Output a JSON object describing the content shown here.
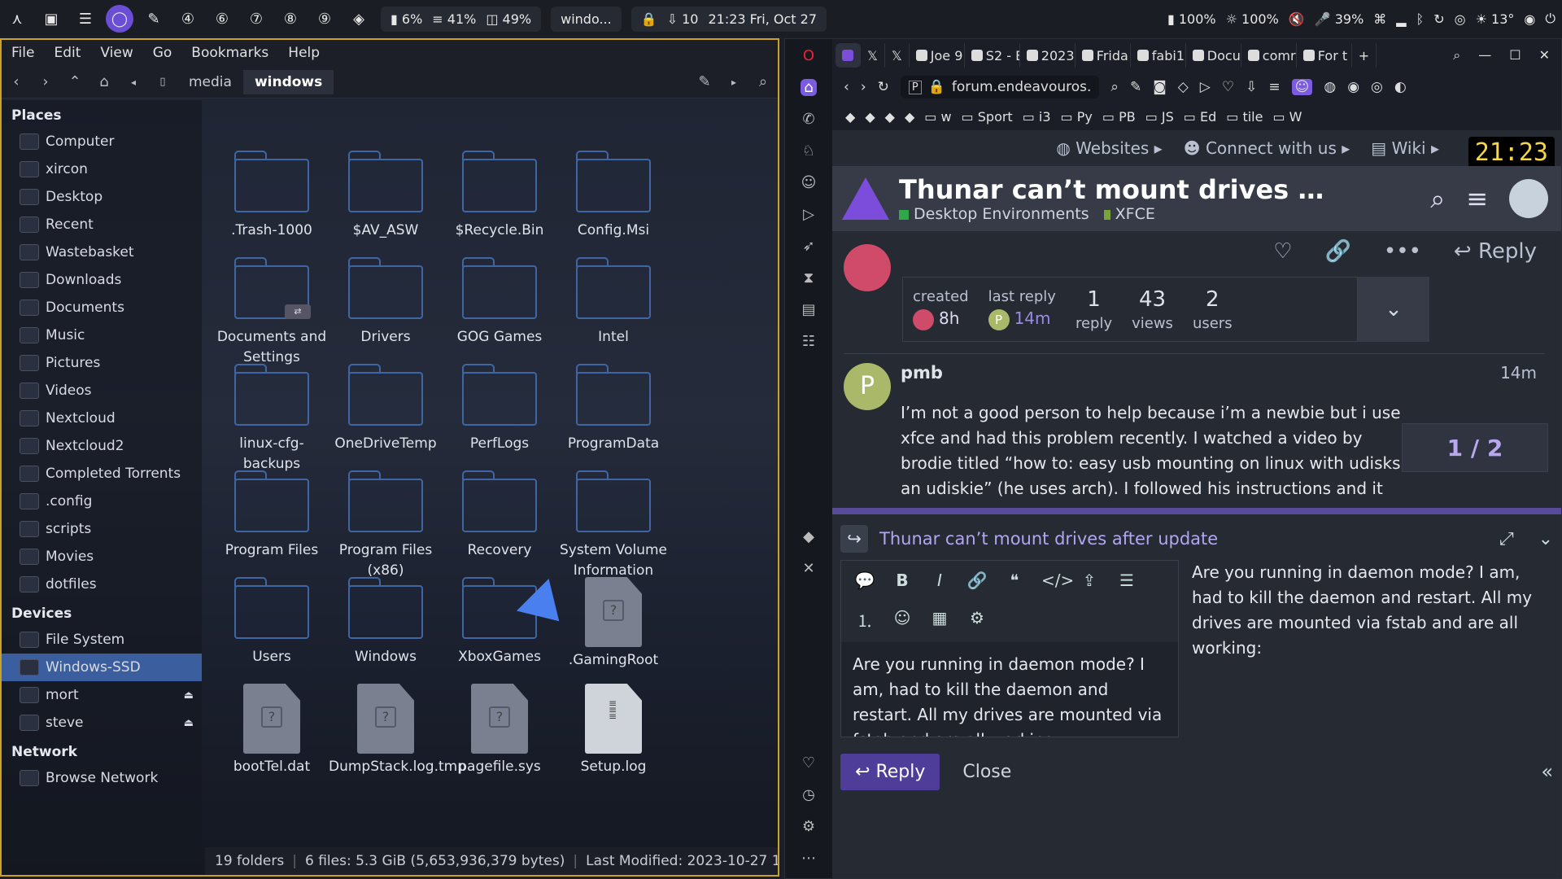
{
  "panel": {
    "cpu": "6%",
    "mem": "41%",
    "disk": "49%",
    "window_title": "windo...",
    "updates": "10",
    "datetime": "21:23 Fri, Oct 27",
    "battery": "100%",
    "brightness": "100%",
    "mic": "39%",
    "temp": "13°"
  },
  "fm": {
    "menu": [
      "File",
      "Edit",
      "View",
      "Go",
      "Bookmarks",
      "Help"
    ],
    "crumbs": [
      "media",
      "windows"
    ],
    "places_head": "Places",
    "places": [
      {
        "label": "Computer",
        "icon": "computer-icon"
      },
      {
        "label": "xircon",
        "icon": "home-folder-icon"
      },
      {
        "label": "Desktop",
        "icon": "desktop-icon"
      },
      {
        "label": "Recent",
        "icon": "recent-icon"
      },
      {
        "label": "Wastebasket",
        "icon": "trash-icon"
      },
      {
        "label": "Downloads",
        "icon": "downloads-folder-icon"
      },
      {
        "label": "Documents",
        "icon": "documents-folder-icon"
      },
      {
        "label": "Music",
        "icon": "music-folder-icon"
      },
      {
        "label": "Pictures",
        "icon": "pictures-folder-icon"
      },
      {
        "label": "Videos",
        "icon": "videos-folder-icon"
      },
      {
        "label": "Nextcloud",
        "icon": "nextcloud-folder-icon"
      },
      {
        "label": "Nextcloud2",
        "icon": "nextcloud-folder-icon"
      },
      {
        "label": "Completed Torrents",
        "icon": "torrent-folder-icon"
      },
      {
        "label": ".config",
        "icon": "folder-icon"
      },
      {
        "label": "scripts",
        "icon": "folder-icon"
      },
      {
        "label": "Movies",
        "icon": "folder-icon"
      },
      {
        "label": "dotfiles",
        "icon": "folder-icon"
      }
    ],
    "devices_head": "Devices",
    "devices": [
      {
        "label": "File System",
        "eject": false
      },
      {
        "label": "Windows-SSD",
        "eject": false
      },
      {
        "label": "mort",
        "eject": true
      },
      {
        "label": "steve",
        "eject": true
      }
    ],
    "network_head": "Network",
    "network": [
      {
        "label": "Browse Network"
      }
    ],
    "items": [
      {
        "label": ".Trash-1000",
        "kind": "folder"
      },
      {
        "label": "$AV_ASW",
        "kind": "folder"
      },
      {
        "label": "$Recycle.Bin",
        "kind": "folder"
      },
      {
        "label": "Config.Msi",
        "kind": "folder"
      },
      {
        "label": "Documents and Settings",
        "kind": "folder-link"
      },
      {
        "label": "Drivers",
        "kind": "folder"
      },
      {
        "label": "GOG Games",
        "kind": "folder"
      },
      {
        "label": "Intel",
        "kind": "folder"
      },
      {
        "label": "linux-cfg-backups",
        "kind": "folder"
      },
      {
        "label": "OneDriveTemp",
        "kind": "folder"
      },
      {
        "label": "PerfLogs",
        "kind": "folder"
      },
      {
        "label": "ProgramData",
        "kind": "folder"
      },
      {
        "label": "Program Files",
        "kind": "folder"
      },
      {
        "label": "Program Files (x86)",
        "kind": "folder"
      },
      {
        "label": "Recovery",
        "kind": "folder"
      },
      {
        "label": "System Volume Information",
        "kind": "folder"
      },
      {
        "label": "Users",
        "kind": "folder"
      },
      {
        "label": "Windows",
        "kind": "folder"
      },
      {
        "label": "XboxGames",
        "kind": "folder"
      },
      {
        "label": ".GamingRoot",
        "kind": "file"
      },
      {
        "label": "bootTel.dat",
        "kind": "file"
      },
      {
        "label": "DumpStack.log.tmp",
        "kind": "file"
      },
      {
        "label": "pagefile.sys",
        "kind": "file"
      },
      {
        "label": "Setup.log",
        "kind": "log"
      }
    ],
    "status": {
      "folders": "19 folders",
      "files": "6 files: 5.3 GiB (5,653,936,379 bytes)",
      "modified": "Last Modified: 2023-10-27 1..."
    }
  },
  "browser": {
    "tabs": [
      "Joe 9",
      "S2 - B",
      "2023",
      "Frida",
      "fabi1",
      "Docu",
      "comr",
      "For t"
    ],
    "url": "forum.endeavouros.",
    "bookmarks": [
      "w",
      "Sport",
      "i3",
      "Py",
      "PB",
      "JS",
      "Ed",
      "tile",
      "W"
    ],
    "nav": [
      "Websites",
      "Connect with us",
      "Wiki"
    ],
    "clock": "21:23",
    "topic_title": "Thunar can’t mount drives after…",
    "category1": "Desktop Environments",
    "category2": "XFCE",
    "reply_action": "Reply",
    "meta": {
      "created_label": "created",
      "created_val": "8h",
      "last_label": "last reply",
      "last_val": "14m",
      "last_initial": "P",
      "replies_num": "1",
      "replies_lbl": "reply",
      "views_num": "43",
      "views_lbl": "views",
      "users_num": "2",
      "users_lbl": "users"
    },
    "post": {
      "initial": "P",
      "author": "pmb",
      "time": "14m",
      "text": "I’m not a good person to help because i’m a newbie but i use xfce and had this problem recently. I watched a video by brodie titled “how to: easy usb mounting on linux with udisks2 an udiskie” (he uses arch). I followed his instructions and it auto mounted and puts an icon in the syst use to eject"
    },
    "counter": "1 / 2",
    "composer": {
      "title": "Thunar can’t mount drives after update",
      "text": "Are you running in daemon mode?  I am, had to kill the daemon and restart.  All my drives are mounted via fstab and are all working:",
      "preview": "Are you running in daemon mode? I am, had to kill the daemon and restart. All my drives are mounted via fstab and are all working:",
      "reply": "Reply",
      "close": "Close"
    }
  }
}
